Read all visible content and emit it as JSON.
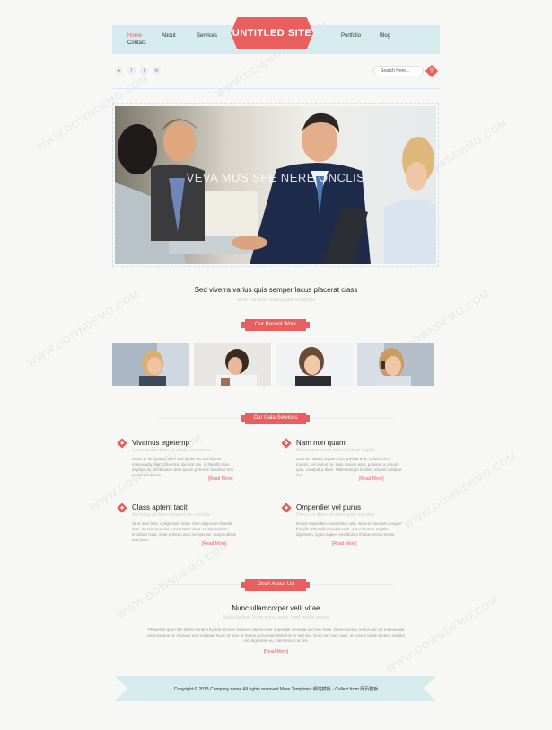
{
  "site": {
    "logo": "UNTITLED SITE"
  },
  "nav": {
    "home": "Home",
    "about": "About",
    "services": "Services",
    "contact": "Contact",
    "portfolio": "Portfolio",
    "blog": "Blog"
  },
  "social": [
    "●",
    "f",
    "t",
    "in"
  ],
  "search": {
    "placeholder": "Search Here..."
  },
  "hero": {
    "caption": "VEVA MUS SPE     NERE ONCLIS"
  },
  "intro": {
    "title": "Sed viverra varius quis semper lacus placerat class",
    "subtitle": "nere conubia nostra per inceptos"
  },
  "recent_work": {
    "label": "Our Recent Work"
  },
  "services": {
    "label": "Our Gala Services",
    "items": [
      {
        "title": "Vivamus egetemp",
        "subtitle": "Lorem ipsum dolor sit amet consectetur",
        "body": "Etiam at leo ipsum. Nam sed ligula nec est lacinia malesuada. Nam pharetra placerat nisi, id blandit risus dapibus et. Vestibulum ante ipsum primis in faucibus orci luctus et ultrices.",
        "more": "[Read More]"
      },
      {
        "title": "Nam non quam",
        "subtitle": "Mauris accumsan nulla vel diam sagittis",
        "body": "Duis ac mauris augue, non gravida erat. Donec id mi mauris, vel varius mi. Duis mauris ante, pulvinar a rutrum quis, volutpat a diam. Pellentesque facilisis nisi vel volutpat dui.",
        "more": "[Read More]"
      },
      {
        "title": "Class aptent taciti",
        "subtitle": "Sociosqu ad litora torquent per conubia",
        "body": "Ut et eros felis, a dignissim dolor. Nam dignissim blandit sem, eu tristique nisl consectetur vitae. Ut elementum tincidunt nulla, vitae pretium arcu semper ac. Suspendisse sed justo.",
        "more": "[Read More]"
      },
      {
        "title": "Omperdiet vel purus",
        "subtitle": "Donec eu libero sit amet quam egestas",
        "body": "Donec imperdiet consectetur odio. Mauris interdum congue fringilla. Phasellus malesuada, est vulputate sagittis dignissim, ligula sapien vestibulum finibus lectus lectus.",
        "more": "[Read More]"
      }
    ]
  },
  "about": {
    "label": "Short About Us",
    "title": "Nunc ullamcorper velit vitae",
    "subtitle": "Nulla facilisi. Ut ac purus eros, eget mollis metus",
    "body": "Phasellus quis nibh libero hendrerit porta. Donec sit amet ullamcorper imperdiet vehicula sed nec enim. Donec luctus, lectus non ac malesuada urna tempus et. Aliquam erat volutpat. Nunc et sem ut metus accumsan interdum in sed nisl. Duis non nunc quis, et cursus lorem dictum sed dui orci dignissim eu, elementum at nisi.",
    "more": "[Read More]"
  },
  "footer": {
    "copyright": "Copyright © 2015 Company name All rights reserved More Templates 網站模板 - Collect from 网页模板"
  },
  "watermark": "WWW.DOWNDEMO.COM",
  "colors": {
    "accent": "#e95e5e",
    "band": "#d5ebee"
  }
}
